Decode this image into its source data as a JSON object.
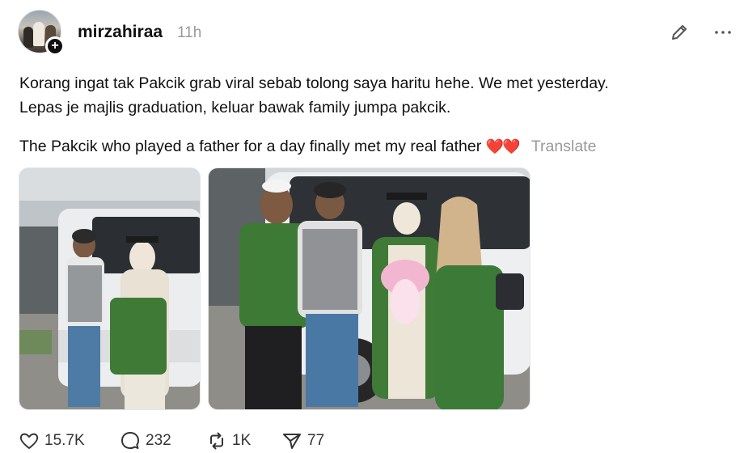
{
  "post": {
    "username": "mirzahiraa",
    "timestamp": "11h",
    "text_line1": "Korang ingat tak Pakcik grab viral sebab tolong saya haritu hehe. We met yesterday.",
    "text_line2": "Lepas je majlis graduation, keluar bawak family jumpa pakcik.",
    "text_line3": "The Pakcik who played a father for a day finally met my real father",
    "hearts": "❤️❤️",
    "translate_label": "Translate"
  },
  "icons": {
    "edit": "pencil-icon",
    "more": "more-horizontal-icon",
    "like": "heart-icon",
    "comment": "comment-bubble-icon",
    "repost": "repost-icon",
    "share": "send-icon"
  },
  "stats": {
    "likes": "15.7K",
    "comments": "232",
    "reposts": "1K",
    "shares": "77"
  },
  "colors": {
    "text": "#101010",
    "muted": "#9a9a9a",
    "heart": "#e0322b"
  }
}
